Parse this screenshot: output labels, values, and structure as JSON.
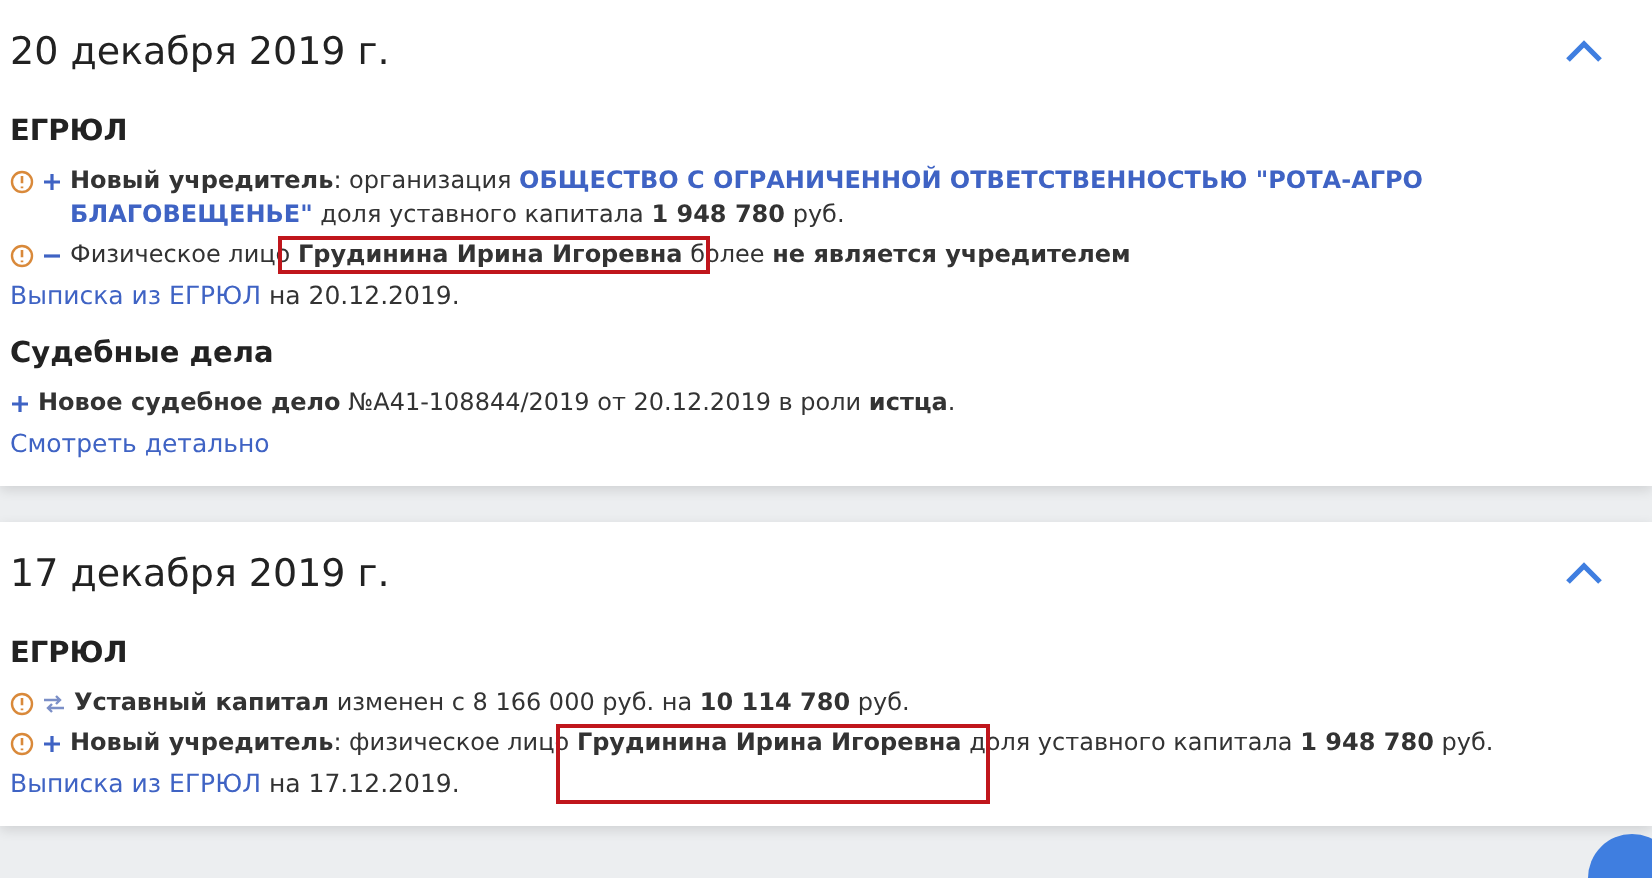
{
  "events": [
    {
      "date": "20 декабря 2019 г.",
      "expanded": true,
      "sections": [
        {
          "title": "ЕГРЮЛ",
          "items": [
            {
              "warning": true,
              "kind": "plus",
              "segments": [
                {
                  "kind": "bold",
                  "text": "Новый учредитель"
                },
                {
                  "kind": "plain",
                  "text": ": организация "
                },
                {
                  "kind": "link",
                  "text": "ОБЩЕСТВО С ОГРАНИЧЕННОЙ ОТВЕТСТВЕННОСТЬЮ \"РОТА-АГРО БЛАГОВЕЩЕНЬЕ\""
                },
                {
                  "kind": "plain",
                  "text": " доля уставного капитала "
                },
                {
                  "kind": "bold",
                  "text": "1 948 780"
                },
                {
                  "kind": "plain",
                  "text": " руб."
                }
              ]
            },
            {
              "warning": true,
              "kind": "minus",
              "segments": [
                {
                  "kind": "plain",
                  "text": "Физическое лицо "
                },
                {
                  "kind": "bold",
                  "text": "Грудинина Ирина Игоревна",
                  "highlighted": true
                },
                {
                  "kind": "plain",
                  "text": " более "
                },
                {
                  "kind": "bold",
                  "text": "не является учредителем"
                }
              ]
            }
          ],
          "footer": {
            "link": "Выписка из ЕГРЮЛ",
            "text": "на 20.12.2019."
          }
        },
        {
          "title": "Судебные дела",
          "items": [
            {
              "warning": false,
              "kind": "plus",
              "segments": [
                {
                  "kind": "bold",
                  "text": "Новое судебное дело"
                },
                {
                  "kind": "plain",
                  "text": " №А41-108844/2019 от 20.12.2019 в роли "
                },
                {
                  "kind": "bold",
                  "text": "истца"
                },
                {
                  "kind": "plain",
                  "text": "."
                }
              ]
            }
          ],
          "footer": {
            "link": "Смотреть детально"
          }
        }
      ]
    },
    {
      "date": "17 декабря 2019 г.",
      "expanded": true,
      "sections": [
        {
          "title": "ЕГРЮЛ",
          "items": [
            {
              "warning": true,
              "kind": "change",
              "segments": [
                {
                  "kind": "bold",
                  "text": "Уставный капитал"
                },
                {
                  "kind": "plain",
                  "text": " изменен с 8 166 000 руб. на "
                },
                {
                  "kind": "bold",
                  "text": "10 114 780"
                },
                {
                  "kind": "plain",
                  "text": " руб."
                }
              ]
            },
            {
              "warning": true,
              "kind": "plus",
              "segments": [
                {
                  "kind": "bold",
                  "text": "Новый учредитель"
                },
                {
                  "kind": "plain",
                  "text": ": физическое лицо "
                },
                {
                  "kind": "bold",
                  "text": "Грудинина Ирина Игоревна",
                  "highlighted": true
                },
                {
                  "kind": "plain",
                  "text": " доля уставного капитала "
                },
                {
                  "kind": "bold",
                  "text": "1 948 780"
                },
                {
                  "kind": "plain",
                  "text": " руб."
                }
              ]
            }
          ],
          "footer": {
            "link": "Выписка из ЕГРЮЛ",
            "text": "на 17.12.2019."
          }
        }
      ]
    }
  ]
}
